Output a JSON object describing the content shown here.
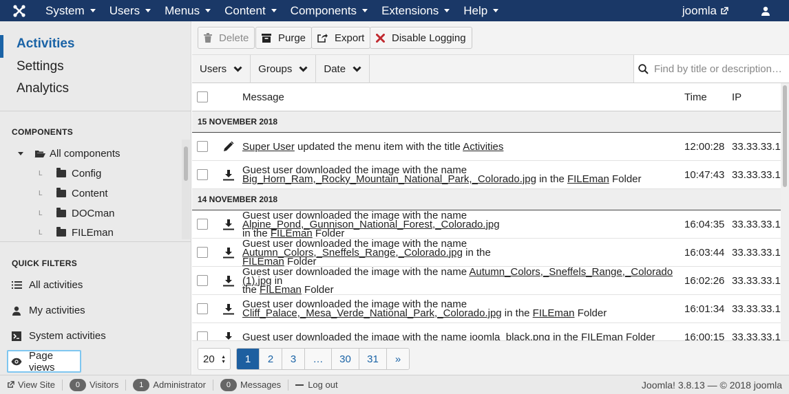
{
  "topbar": {
    "logo_icon": "joomla-logo-icon",
    "menu": [
      "System",
      "Users",
      "Menus",
      "Content",
      "Components",
      "Extensions",
      "Help"
    ],
    "site_name": "joomla",
    "site_link_icon": "external-link-icon",
    "user_icon": "user-icon"
  },
  "sidebar": {
    "submenu": [
      "Activities",
      "Settings",
      "Analytics"
    ],
    "components_title": "COMPONENTS",
    "tree_root": "All components",
    "tree_children": [
      "Config",
      "Content",
      "DOCman",
      "FILEman"
    ],
    "quick_filters_title": "QUICK FILTERS",
    "quick_filters": [
      "All activities",
      "My activities",
      "System activities",
      "Page views"
    ]
  },
  "toolbar": {
    "delete": "Delete",
    "purge": "Purge",
    "export": "Export",
    "disable_logging": "Disable Logging"
  },
  "filters": {
    "users": "Users",
    "groups": "Groups",
    "date": "Date",
    "search_placeholder": "Find by title or description…"
  },
  "table": {
    "headers": {
      "message": "Message",
      "time": "Time",
      "ip": "IP"
    },
    "groups": [
      "15 NOVEMBER 2018",
      "14 NOVEMBER 2018"
    ],
    "rows": [
      {
        "icon": "pencil-icon",
        "a": "Super User",
        "b": " updated the menu item with the title ",
        "c": "Activities",
        "d": "",
        "e": "",
        "f": "",
        "time": "12:00:28",
        "ip": "33.33.33.1"
      },
      {
        "icon": "download-icon",
        "a": "Guest user downloaded the image with the name",
        "b": "Big_Horn_Ram,_Rocky_Mountain_National_Park,_Colorado.jpg",
        "c": " in the ",
        "d": "FILEman",
        "e": " Folder",
        "f": "",
        "time": "10:47:43",
        "ip": "33.33.33.1"
      },
      {
        "icon": "download-icon",
        "a": "Guest user downloaded the image with the name ",
        "b": "Alpine_Pond,_Gunnison_National_Forest,_Colorado.jpg",
        "c": "in the ",
        "d": "FILEman",
        "e": " Folder",
        "f": "",
        "time": "16:04:35",
        "ip": "33.33.33.1"
      },
      {
        "icon": "download-icon",
        "a": "Guest user downloaded the image with the name ",
        "b": "Autumn_Colors,_Sneffels_Range,_Colorado.jpg",
        "c": " in the",
        "d": "FILEman",
        "e": " Folder",
        "f": "",
        "time": "16:03:44",
        "ip": "33.33.33.1"
      },
      {
        "icon": "download-icon",
        "a": "Guest user downloaded the image with the name ",
        "b": "Autumn_Colors,_Sneffels_Range,_Colorado (1).jpg",
        "c": " in",
        "d": "the ",
        "e": "FILEman",
        "f": " Folder",
        "time": "16:02:26",
        "ip": "33.33.33.1"
      },
      {
        "icon": "download-icon",
        "a": "Guest user downloaded the image with the name",
        "b": "Cliff_Palace,_Mesa_Verde_National_Park,_Colorado.jpg",
        "c": " in the ",
        "d": "FILEman",
        "e": " Folder",
        "f": "",
        "time": "16:01:34",
        "ip": "33.33.33.1"
      },
      {
        "icon": "download-icon",
        "a": "Guest user downloaded the image with the name ",
        "b": "joomla_black.png",
        "c": " in the ",
        "d": "FILEman",
        "e": " Folder",
        "f": "",
        "time": "16:00:15",
        "ip": "33.33.33.1"
      }
    ]
  },
  "pagination": {
    "limit": "20",
    "pages": [
      "1",
      "2",
      "3",
      "…",
      "30",
      "31",
      "»"
    ]
  },
  "statusbar": {
    "view_site": "View Site",
    "visitors_count": "0",
    "visitors": "Visitors",
    "admin_count": "1",
    "admin": "Administrator",
    "messages_count": "0",
    "messages": "Messages",
    "logout": "Log out",
    "version": "Joomla! 3.8.13  —  © 2018 joomla"
  },
  "colors": {
    "topbar": "#1a3867",
    "accent": "#1a63a6",
    "delete_red": "#c0292f"
  }
}
